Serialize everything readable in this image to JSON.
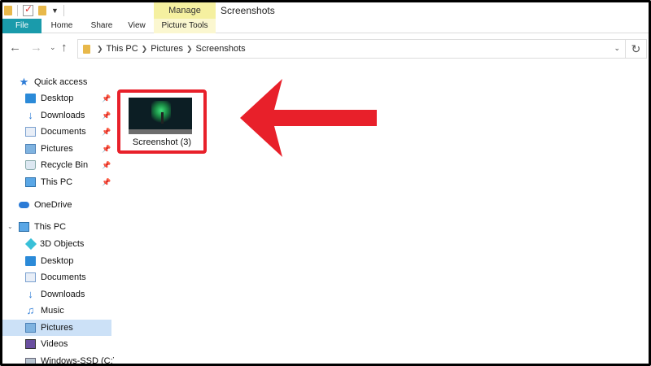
{
  "ribbon": {
    "manage_label": "Manage",
    "window_title": "Screenshots",
    "tabs": [
      "File",
      "Home",
      "Share",
      "View",
      "Picture Tools"
    ]
  },
  "address": {
    "crumbs": [
      "This PC",
      "Pictures",
      "Screenshots"
    ]
  },
  "navpane": {
    "quick_access": "Quick access",
    "quick_items": [
      "Desktop",
      "Downloads",
      "Documents",
      "Pictures",
      "Recycle Bin",
      "This PC"
    ],
    "onedrive": "OneDrive",
    "this_pc": "This PC",
    "pc_items": [
      "3D Objects",
      "Desktop",
      "Documents",
      "Downloads",
      "Music",
      "Pictures",
      "Videos",
      "Windows-SSD (C:)"
    ],
    "selected": "Pictures"
  },
  "content": {
    "file_name": "Screenshot (3)"
  },
  "colors": {
    "file_tab": "#1a9bab",
    "manage_tab": "#f5f0a0",
    "highlight_red": "#e8202a",
    "selected_bg": "#cce1f7"
  }
}
